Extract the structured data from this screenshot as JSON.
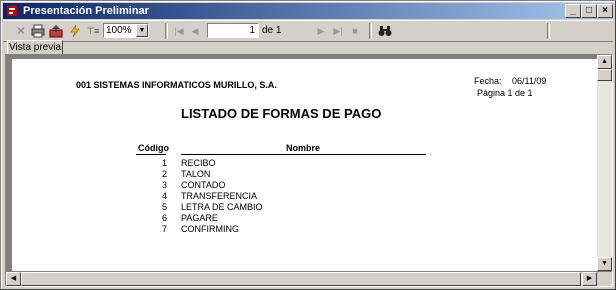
{
  "window": {
    "title": "Presentación Preliminar"
  },
  "toolbar": {
    "zoom_value": "100%",
    "page_current": "1",
    "page_total": "de 1"
  },
  "tabs": {
    "preview": "Vista previa"
  },
  "report": {
    "company": "001   SISTEMAS INFORMATICOS MURILLO, S.A.",
    "date_label": "Fecha:",
    "date_value": "06/11/09",
    "page_label": "Página 1 de 1",
    "title": "LISTADO DE FORMAS DE PAGO",
    "col_code": "Código",
    "col_name": "Nombre",
    "rows": [
      {
        "code": "1",
        "name": "RECIBO"
      },
      {
        "code": "2",
        "name": "TALON"
      },
      {
        "code": "3",
        "name": "CONTADO"
      },
      {
        "code": "4",
        "name": "TRANSFERENCIA"
      },
      {
        "code": "5",
        "name": "LETRA DE CAMBIO"
      },
      {
        "code": "6",
        "name": "PAGARE"
      },
      {
        "code": "7",
        "name": "CONFIRMING"
      }
    ]
  }
}
